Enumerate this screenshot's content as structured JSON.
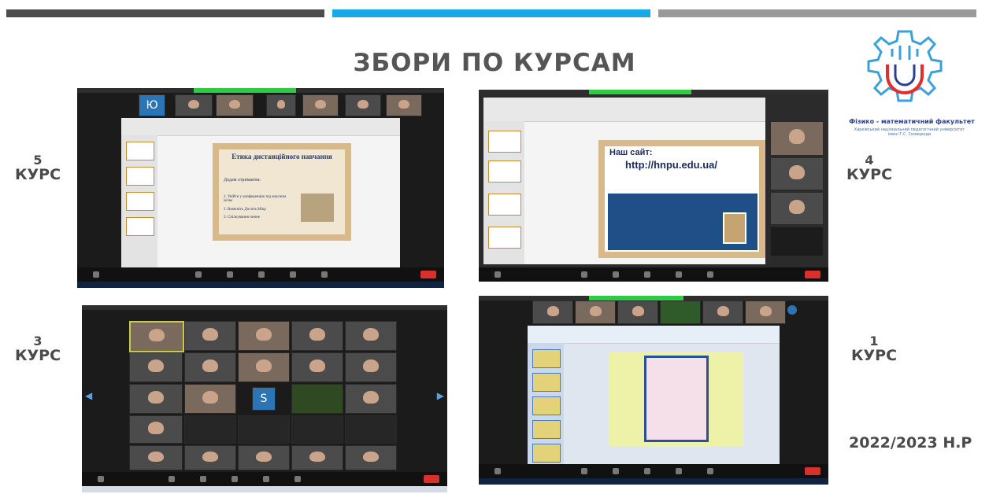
{
  "header": {
    "title": "ЗБОРИ ПО КУРСАМ",
    "bar_colors": [
      "#4d4d4d",
      "#1aa7e6",
      "#9a9a9a"
    ]
  },
  "courses": {
    "c5": {
      "num": "5",
      "label": "КУРС"
    },
    "c4": {
      "num": "4",
      "label": "КУРС"
    },
    "c3": {
      "num": "3",
      "label": "КУРС"
    },
    "c1": {
      "num": "1",
      "label": "КУРС"
    }
  },
  "academic_year": "2022/2023 Н.Р",
  "logo": {
    "faculty": "Фізико - математичний факультет",
    "university": "Харківський національний педагогічний університет імені Г.С. Сковороди"
  },
  "screenshot_5": {
    "avatar_letter": "Ю",
    "slide_title": "Етика дистанційного навчання",
    "slide_subtitle": "Додам отримання:",
    "slide_items": [
      "1. Увійти у конференцію під власним ім'ям",
      "2. Вимкніть Досить Мікр",
      "3. Спілкування чемне"
    ]
  },
  "screenshot_4": {
    "site_label": "Наш сайт:",
    "site_url": "http://hnpu.edu.ua/"
  },
  "screenshot_3": {
    "avatar_letter": "S"
  },
  "colors": {
    "accent_red": "#d9302c",
    "zoom_green": "#2ecc40"
  }
}
